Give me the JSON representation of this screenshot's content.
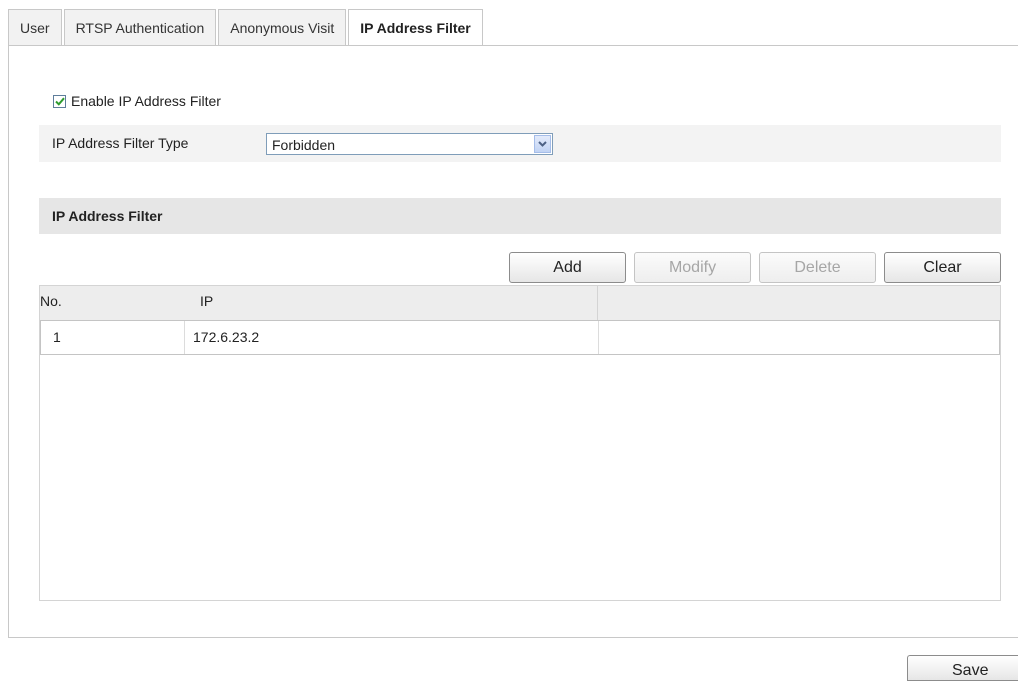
{
  "tabs": [
    {
      "label": "User"
    },
    {
      "label": "RTSP Authentication"
    },
    {
      "label": "Anonymous Visit"
    },
    {
      "label": "IP Address Filter",
      "active": true
    }
  ],
  "enable_filter": {
    "label": "Enable IP Address Filter",
    "checked": true
  },
  "filter_type": {
    "label": "IP Address Filter Type",
    "value": "Forbidden"
  },
  "section": {
    "title": "IP Address Filter"
  },
  "buttons": {
    "add": "Add",
    "modify": "Modify",
    "delete": "Delete",
    "clear": "Clear"
  },
  "table": {
    "headers": [
      "No.",
      "IP"
    ],
    "rows": [
      {
        "no": "1",
        "ip": "172.6.23.2"
      }
    ]
  },
  "save_label": "Save",
  "colors": {
    "checkbox_check": "#2e9c2e",
    "header_bg": "#e6e6e6",
    "disabled_text": "#a6a6a6"
  },
  "icons": {
    "checkbox": "checkmark-icon",
    "dropdown": "chevron-down-icon"
  }
}
